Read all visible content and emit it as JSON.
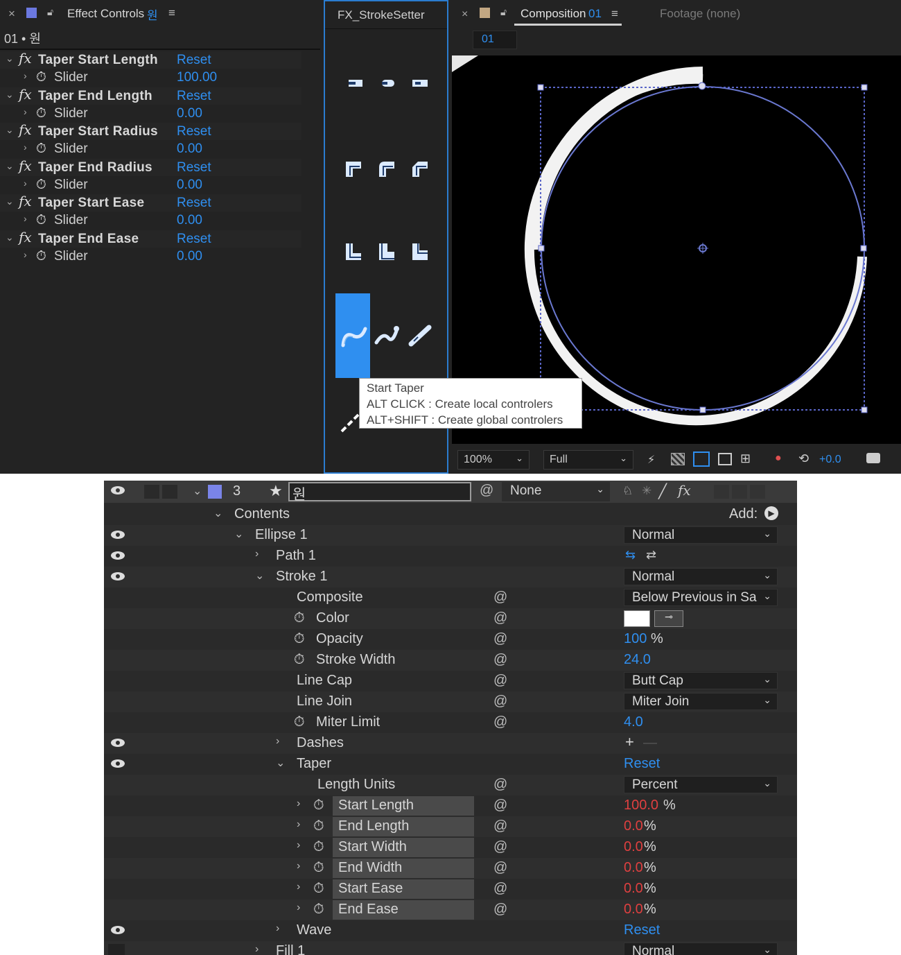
{
  "effect_controls": {
    "close": "×",
    "title": "Effect Controls",
    "layer_tag": "원",
    "menu": "≡",
    "subtitle": "01 • 원",
    "rows": [
      {
        "fx": "fx",
        "name": "Taper Start Length",
        "reset": "Reset",
        "slider": "Slider",
        "value": "100.00"
      },
      {
        "fx": "fx",
        "name": "Taper End Length",
        "reset": "Reset",
        "slider": "Slider",
        "value": "0.00"
      },
      {
        "fx": "fx",
        "name": "Taper Start Radius",
        "reset": "Reset",
        "slider": "Slider",
        "value": "0.00"
      },
      {
        "fx": "fx",
        "name": "Taper End Radius",
        "reset": "Reset",
        "slider": "Slider",
        "value": "0.00"
      },
      {
        "fx": "fx",
        "name": "Taper Start Ease",
        "reset": "Reset",
        "slider": "Slider",
        "value": "0.00"
      },
      {
        "fx": "fx",
        "name": "Taper End Ease",
        "reset": "Reset",
        "slider": "Slider",
        "value": "0.00"
      }
    ]
  },
  "fx_panel": {
    "title": "FX_StrokeSetter"
  },
  "composition": {
    "close": "×",
    "title": "Composition",
    "comp_num": "01",
    "menu": "≡",
    "footage": "Footage (none)",
    "tab_01": "01",
    "zoom": "100%",
    "resolution": "Full",
    "exposure": "+0.0"
  },
  "tooltip": {
    "line1": "Start Taper",
    "line2": "ALT CLICK : Create local controlers",
    "line3": "ALT+SHIFT : Create global controlers"
  },
  "timeline": {
    "layer_num": "3",
    "layer_name": "원",
    "parent": "None",
    "contents": "Contents",
    "add": "Add:",
    "rows": {
      "ellipse": {
        "label": "Ellipse 1",
        "mode": "Normal"
      },
      "path": {
        "label": "Path 1"
      },
      "stroke": {
        "label": "Stroke 1",
        "mode": "Normal"
      },
      "composite": {
        "label": "Composite",
        "value": "Below Previous in Sa"
      },
      "color": {
        "label": "Color"
      },
      "opacity": {
        "label": "Opacity",
        "value": "100",
        "unit": "%"
      },
      "stroke_width": {
        "label": "Stroke Width",
        "value": "24.0"
      },
      "line_cap": {
        "label": "Line Cap",
        "value": "Butt Cap"
      },
      "line_join": {
        "label": "Line Join",
        "value": "Miter Join"
      },
      "miter_limit": {
        "label": "Miter Limit",
        "value": "4.0"
      },
      "dashes": {
        "label": "Dashes",
        "add": "+",
        "remove": "—"
      },
      "taper": {
        "label": "Taper",
        "reset": "Reset"
      },
      "length_units": {
        "label": "Length Units",
        "value": "Percent"
      },
      "start_length": {
        "label": "Start Length",
        "value": "100.0",
        "unit": "%"
      },
      "end_length": {
        "label": "End Length",
        "value": "0.0",
        "unit": "%"
      },
      "start_width": {
        "label": "Start Width",
        "value": "0.0",
        "unit": "%"
      },
      "end_width": {
        "label": "End Width",
        "value": "0.0",
        "unit": "%"
      },
      "start_ease": {
        "label": "Start Ease",
        "value": "0.0",
        "unit": "%"
      },
      "end_ease": {
        "label": "End Ease",
        "value": "0.0",
        "unit": "%"
      },
      "wave": {
        "label": "Wave",
        "reset": "Reset"
      },
      "fill": {
        "label": "Fill 1",
        "mode": "Normal"
      }
    }
  }
}
